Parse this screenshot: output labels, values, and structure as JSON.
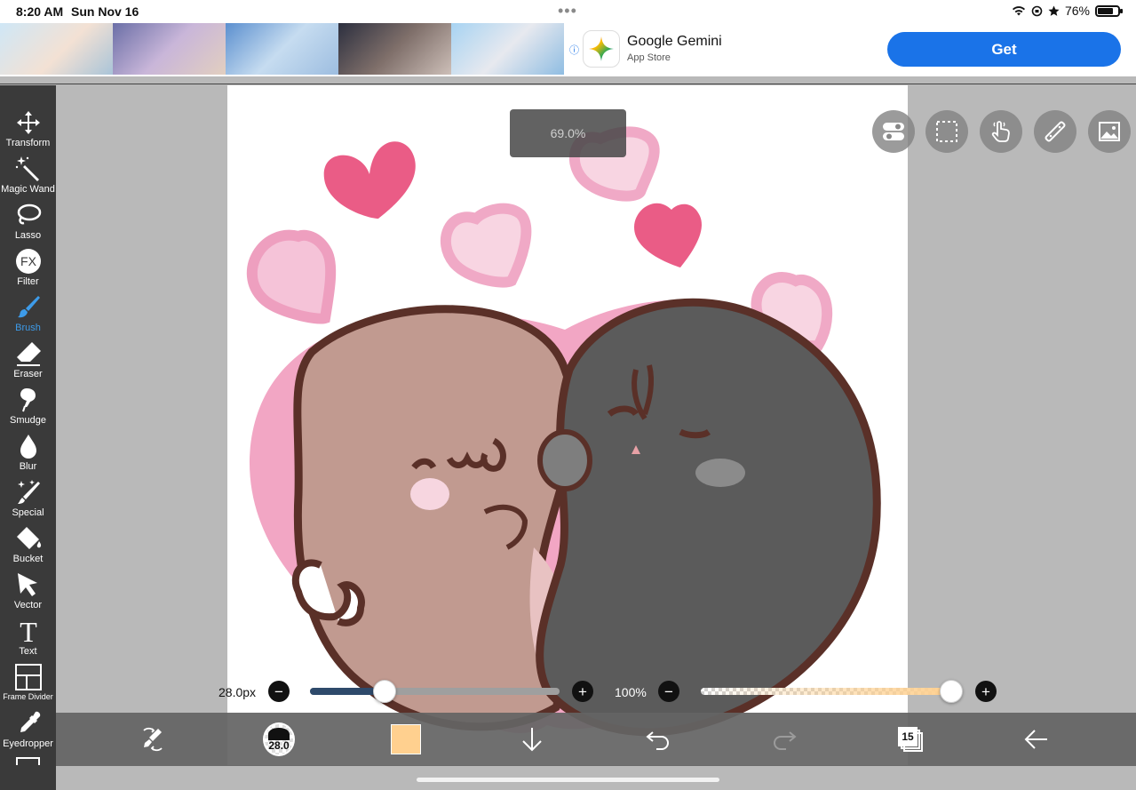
{
  "status_bar": {
    "time": "8:20 AM",
    "date": "Sun Nov 16",
    "dots": "•••",
    "battery": "76%",
    "battery_level": 0.76
  },
  "ad": {
    "title": "Google Gemini",
    "subtitle": "App Store",
    "get_label": "Get",
    "info_glyph": "ⓘ",
    "accent_color": "#1a73e8"
  },
  "tools": [
    {
      "id": "transform",
      "label": "Transform",
      "icon": "move-arrows-icon"
    },
    {
      "id": "magic-wand",
      "label": "Magic Wand",
      "icon": "magic-wand-icon"
    },
    {
      "id": "lasso",
      "label": "Lasso",
      "icon": "lasso-icon"
    },
    {
      "id": "filter",
      "label": "Filter",
      "icon": "fx-icon",
      "glyph": "FX"
    },
    {
      "id": "brush",
      "label": "Brush",
      "icon": "brush-icon",
      "active": true
    },
    {
      "id": "eraser",
      "label": "Eraser",
      "icon": "eraser-icon"
    },
    {
      "id": "smudge",
      "label": "Smudge",
      "icon": "smudge-icon"
    },
    {
      "id": "blur",
      "label": "Blur",
      "icon": "drop-icon"
    },
    {
      "id": "special",
      "label": "Special",
      "icon": "sparkle-brush-icon"
    },
    {
      "id": "bucket",
      "label": "Bucket",
      "icon": "bucket-icon"
    },
    {
      "id": "vector",
      "label": "Vector",
      "icon": "cursor-arrow-icon"
    },
    {
      "id": "text",
      "label": "Text",
      "icon": "text-icon",
      "glyph": "T"
    },
    {
      "id": "frame-divider",
      "label": "Frame Divider",
      "icon": "frame-divider-icon"
    },
    {
      "id": "eyedropper",
      "label": "Eyedropper",
      "icon": "eyedropper-icon"
    }
  ],
  "canvas": {
    "zoom": "69.0%"
  },
  "top_right_buttons": [
    {
      "id": "toggle",
      "icon": "toggle-switch-icon"
    },
    {
      "id": "selection",
      "icon": "dashed-selection-icon"
    },
    {
      "id": "touch",
      "icon": "hand-touch-icon"
    },
    {
      "id": "ruler",
      "icon": "ruler-icon"
    },
    {
      "id": "image",
      "icon": "image-icon"
    }
  ],
  "brush_size_slider": {
    "label": "28.0px",
    "value": 0.3,
    "minus": "−",
    "plus": "+",
    "fill_color": "#2e4a6b"
  },
  "opacity_slider": {
    "label": "100%",
    "value": 1.0,
    "minus": "−",
    "plus": "+",
    "fill_color": "#ffd08f"
  },
  "bottom_bar": {
    "brush_size_value": "28.0",
    "current_color": "#ffd08f",
    "layers_count": "15"
  }
}
